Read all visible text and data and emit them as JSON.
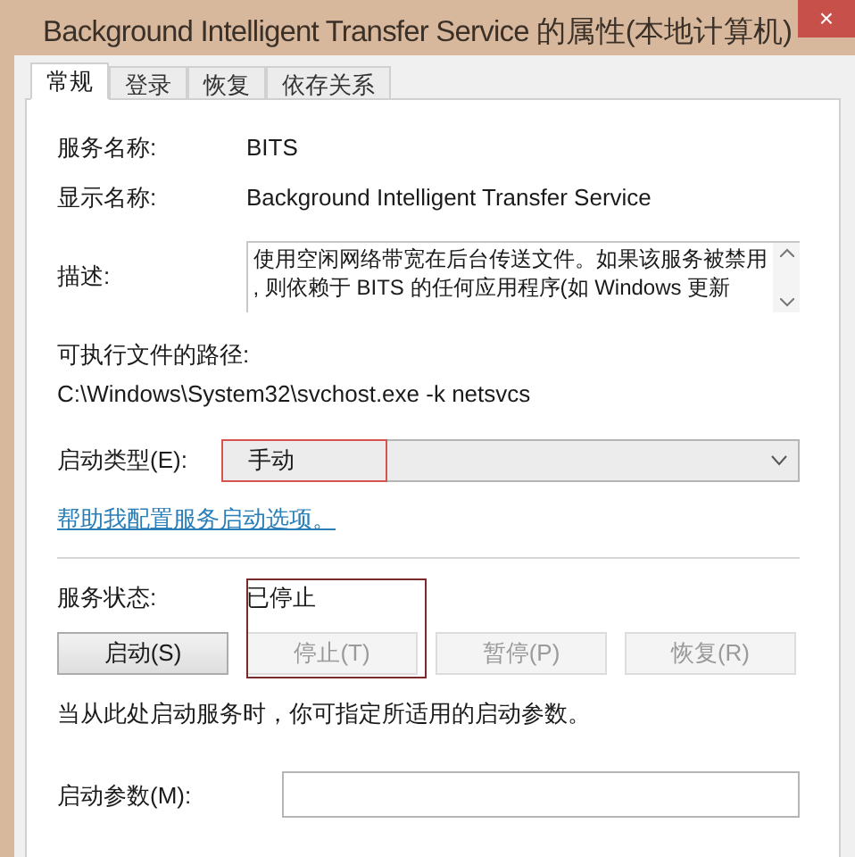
{
  "window": {
    "title": "Background Intelligent Transfer Service 的属性(本地计算机)",
    "close": "×"
  },
  "tabs": [
    {
      "label": "常规",
      "selected": true
    },
    {
      "label": "登录",
      "selected": false
    },
    {
      "label": "恢复",
      "selected": false
    },
    {
      "label": "依存关系",
      "selected": false
    }
  ],
  "info": [
    {
      "label": "服务名称:",
      "value": "BITS"
    },
    {
      "label": "显示名称:",
      "value": "Background Intelligent Transfer Service"
    }
  ],
  "description": {
    "label": "描述:",
    "lines": [
      "使用空闲网络带宽在后台传送文件。如果该服务被禁用",
      ", 则依赖于 BITS 的任何应用程序(如 Windows 更新"
    ]
  },
  "path": {
    "label": "可执行文件的路径:",
    "value": "C:\\Windows\\System32\\svchost.exe -k netsvcs"
  },
  "startup_type": {
    "label": "启动类型(E):",
    "value": "手动"
  },
  "help_link": "帮助我配置服务启动选项。",
  "service_status": {
    "label": "服务状态:",
    "value": "已停止"
  },
  "buttons": [
    {
      "label": "启动(S)",
      "disabled": false
    },
    {
      "label": "停止(T)",
      "disabled": true
    },
    {
      "label": "暂停(P)",
      "disabled": true
    },
    {
      "label": "恢复(R)",
      "disabled": true
    }
  ],
  "note": "当从此处启动服务时，你可指定所适用的启动参数。",
  "start_parameters": {
    "label": "启动参数(M):"
  }
}
